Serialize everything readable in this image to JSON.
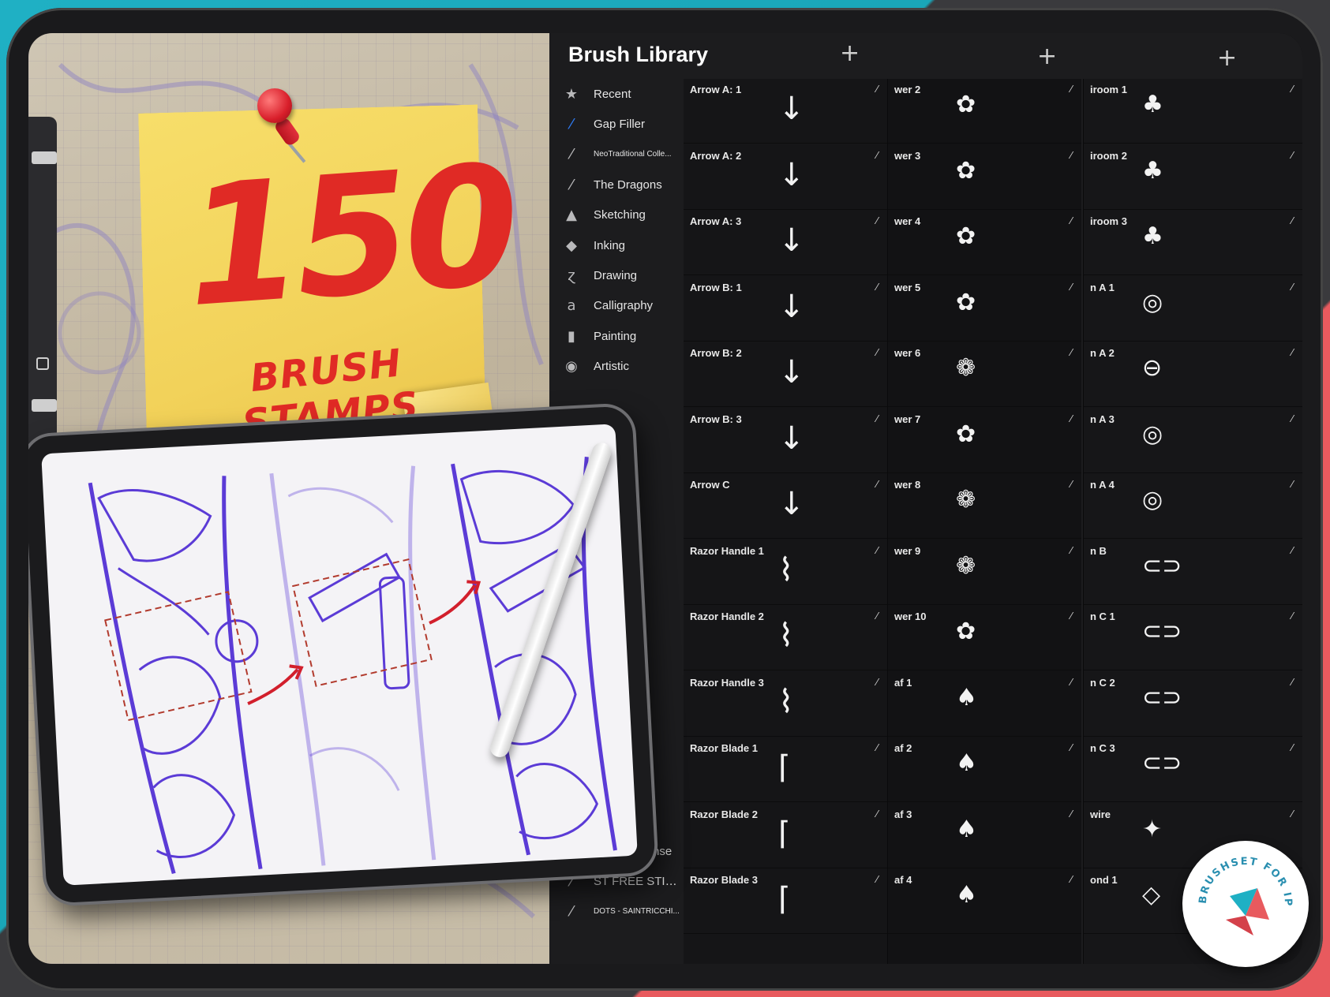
{
  "headline": {
    "number": "150",
    "subtitle": "BRUSH STAMPS"
  },
  "badge": {
    "text": "BRUSHSET FOR IPAD ONLY"
  },
  "panel": {
    "title": "Brush Library",
    "plus": "+",
    "categories": [
      {
        "icon": "★",
        "label": "Recent"
      },
      {
        "icon": "⁄",
        "label": "Gap Filler"
      },
      {
        "icon": "⁄",
        "label": "NeoTraditional Colle..."
      },
      {
        "icon": "⁄",
        "label": "The Dragons"
      },
      {
        "icon": "▲",
        "label": "Sketching"
      },
      {
        "icon": "◆",
        "label": "Inking"
      },
      {
        "icon": "ɀ",
        "label": "Drawing"
      },
      {
        "icon": "a",
        "label": "Calligraphy"
      },
      {
        "icon": "▮",
        "label": "Painting"
      },
      {
        "icon": "◉",
        "label": "Artistic"
      }
    ],
    "bottom_categories": [
      {
        "icon": "⁄",
        "label": "Stipple Intense"
      },
      {
        "icon": "⁄",
        "label": "ST FREE STIPPLE"
      },
      {
        "icon": "⁄",
        "label": "DOTS - SAINTRICCHI..."
      }
    ],
    "stroke_glyph": "⁄",
    "column1": [
      {
        "name": "Arrow A: 1",
        "stamp": "↓"
      },
      {
        "name": "Arrow A: 2",
        "stamp": "↓"
      },
      {
        "name": "Arrow A: 3",
        "stamp": "↓"
      },
      {
        "name": "Arrow B: 1",
        "stamp": "↓"
      },
      {
        "name": "Arrow B: 2",
        "stamp": "↓"
      },
      {
        "name": "Arrow B: 3",
        "stamp": "↓"
      },
      {
        "name": "Arrow C",
        "stamp": "↓"
      },
      {
        "name": "Razor Handle 1",
        "stamp": "⌇"
      },
      {
        "name": "Razor Handle 2",
        "stamp": "⌇"
      },
      {
        "name": "Razor Handle 3",
        "stamp": "⌇"
      },
      {
        "name": "Razor Blade 1",
        "stamp": "⌈"
      },
      {
        "name": "Razor Blade 2",
        "stamp": "⌈"
      },
      {
        "name": "Razor Blade 3",
        "stamp": "⌈"
      }
    ],
    "column2": [
      {
        "name": "wer 2",
        "stamp": "✿"
      },
      {
        "name": "wer 3",
        "stamp": "✿"
      },
      {
        "name": "wer 4",
        "stamp": "✿"
      },
      {
        "name": "wer 5",
        "stamp": "✿"
      },
      {
        "name": "wer 6",
        "stamp": "❁"
      },
      {
        "name": "wer 7",
        "stamp": "✿"
      },
      {
        "name": "wer 8",
        "stamp": "❁"
      },
      {
        "name": "wer 9",
        "stamp": "❁"
      },
      {
        "name": "wer 10",
        "stamp": "✿"
      },
      {
        "name": "af 1",
        "stamp": "♠"
      },
      {
        "name": "af 2",
        "stamp": "♠"
      },
      {
        "name": "af 3",
        "stamp": "♠"
      },
      {
        "name": "af 4",
        "stamp": "♠"
      }
    ],
    "column3": [
      {
        "name": "iroom 1",
        "stamp": "♣"
      },
      {
        "name": "iroom 2",
        "stamp": "♣"
      },
      {
        "name": "iroom 3",
        "stamp": "♣"
      },
      {
        "name": "n A 1",
        "stamp": "◎"
      },
      {
        "name": "n A 2",
        "stamp": "⊖"
      },
      {
        "name": "n A 3",
        "stamp": "◎"
      },
      {
        "name": "n A 4",
        "stamp": "◎"
      },
      {
        "name": "n B",
        "stamp": "⊂⊃"
      },
      {
        "name": "n C 1",
        "stamp": "⊂⊃"
      },
      {
        "name": "n C 2",
        "stamp": "⊂⊃"
      },
      {
        "name": "n C 3",
        "stamp": "⊂⊃"
      },
      {
        "name": "wire",
        "stamp": "✦"
      },
      {
        "name": "ond 1",
        "stamp": "◇"
      }
    ]
  },
  "colors": {
    "accent_teal": "#1fb0c4",
    "accent_red": "#e85a5e",
    "headline_red": "#e02a25",
    "sticky_yellow": "#f2d25a",
    "sketch_purple": "#5b3bd6",
    "selection_blue": "#2f7cf6"
  }
}
